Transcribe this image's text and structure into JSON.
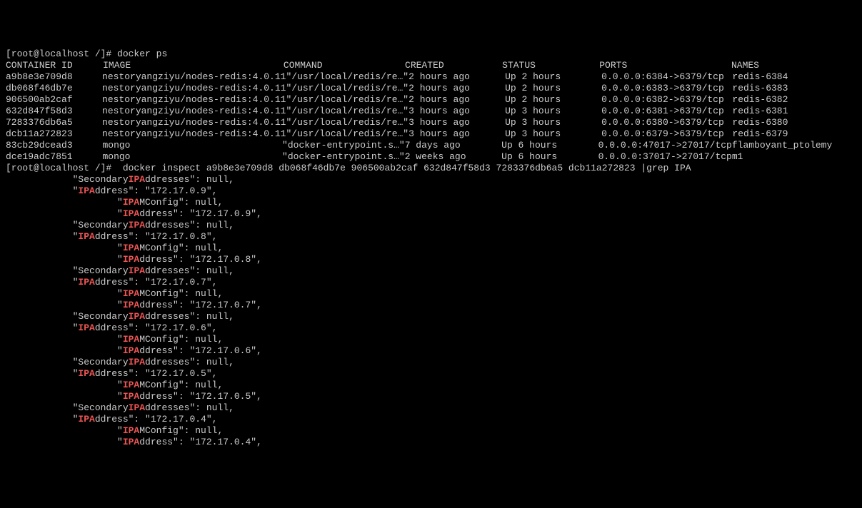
{
  "prompt1": "[root@localhost /]# ",
  "cmd1": "docker ps",
  "headers": {
    "container_id": "CONTAINER ID",
    "image": "IMAGE",
    "command": "COMMAND",
    "created": "CREATED",
    "status": "STATUS",
    "ports": "PORTS",
    "names": "NAMES"
  },
  "containers": [
    {
      "id": "a9b8e3e709d8",
      "image": "nestoryangziyu/nodes-redis:4.0.11",
      "command": "\"/usr/local/redis/re…\"",
      "created": "2 hours ago",
      "status": "Up 2 hours",
      "ports": "0.0.0.0:6384->6379/tcp",
      "names": "redis-6384"
    },
    {
      "id": "db068f46db7e",
      "image": "nestoryangziyu/nodes-redis:4.0.11",
      "command": "\"/usr/local/redis/re…\"",
      "created": "2 hours ago",
      "status": "Up 2 hours",
      "ports": "0.0.0.0:6383->6379/tcp",
      "names": "redis-6383"
    },
    {
      "id": "906500ab2caf",
      "image": "nestoryangziyu/nodes-redis:4.0.11",
      "command": "\"/usr/local/redis/re…\"",
      "created": "2 hours ago",
      "status": "Up 2 hours",
      "ports": "0.0.0.0:6382->6379/tcp",
      "names": "redis-6382"
    },
    {
      "id": "632d847f58d3",
      "image": "nestoryangziyu/nodes-redis:4.0.11",
      "command": "\"/usr/local/redis/re…\"",
      "created": "3 hours ago",
      "status": "Up 3 hours",
      "ports": "0.0.0.0:6381->6379/tcp",
      "names": "redis-6381"
    },
    {
      "id": "7283376db6a5",
      "image": "nestoryangziyu/nodes-redis:4.0.11",
      "command": "\"/usr/local/redis/re…\"",
      "created": "3 hours ago",
      "status": "Up 3 hours",
      "ports": "0.0.0.0:6380->6379/tcp",
      "names": "redis-6380"
    },
    {
      "id": "dcb11a272823",
      "image": "nestoryangziyu/nodes-redis:4.0.11",
      "command": "\"/usr/local/redis/re…\"",
      "created": "3 hours ago",
      "status": "Up 3 hours",
      "ports": "0.0.0.0:6379->6379/tcp",
      "names": "redis-6379"
    },
    {
      "id": "83cb29dcead3",
      "image": "mongo",
      "command": "\"docker-entrypoint.s…\"",
      "created": "7 days ago",
      "status": "Up 6 hours",
      "ports": "0.0.0.0:47017->27017/tcp",
      "names": "flamboyant_ptolemy"
    },
    {
      "id": "dce19adc7851",
      "image": "mongo",
      "command": "\"docker-entrypoint.s…\"",
      "created": "2 weeks ago",
      "status": "Up 6 hours",
      "ports": "0.0.0.0:37017->27017/tcp",
      "names": "m1"
    }
  ],
  "prompt2": "[root@localhost /]#  ",
  "cmd2": "docker inspect a9b8e3e709d8 db068f46db7e 906500ab2caf 632d847f58d3 7283376db6a5 dcb11a272823 |grep IPA",
  "grep_blocks": [
    {
      "sec": "            \"Secondary",
      "sec_x": "ddresses\": null,",
      "ipa": "            \"",
      "ip": "172.17.0.9",
      "cfg": "                    \"",
      "cfg_tail": "MConfig\": null,",
      "in": "                    \"",
      "in_tail": "ddress\": \"172.17.0.9\","
    },
    {
      "sec": "            \"Secondary",
      "sec_x": "ddresses\": null,",
      "ipa": "            \"",
      "ip": "172.17.0.8",
      "cfg": "                    \"",
      "cfg_tail": "MConfig\": null,",
      "in": "                    \"",
      "in_tail": "ddress\": \"172.17.0.8\","
    },
    {
      "sec": "            \"Secondary",
      "sec_x": "ddresses\": null,",
      "ipa": "            \"",
      "ip": "172.17.0.7",
      "cfg": "                    \"",
      "cfg_tail": "MConfig\": null,",
      "in": "                    \"",
      "in_tail": "ddress\": \"172.17.0.7\","
    },
    {
      "sec": "            \"Secondary",
      "sec_x": "ddresses\": null,",
      "ipa": "            \"",
      "ip": "172.17.0.6",
      "cfg": "                    \"",
      "cfg_tail": "MConfig\": null,",
      "in": "                    \"",
      "in_tail": "ddress\": \"172.17.0.6\","
    },
    {
      "sec": "            \"Secondary",
      "sec_x": "ddresses\": null,",
      "ipa": "            \"",
      "ip": "172.17.0.5",
      "cfg": "                    \"",
      "cfg_tail": "MConfig\": null,",
      "in": "                    \"",
      "in_tail": "ddress\": \"172.17.0.5\","
    },
    {
      "sec": "            \"Secondary",
      "sec_x": "ddresses\": null,",
      "ipa": "            \"",
      "ip": "172.17.0.4",
      "cfg": "                    \"",
      "cfg_tail": "MConfig\": null,",
      "in": "                    \"",
      "in_tail": "ddress\": \"172.17.0.4\","
    }
  ],
  "ipa_hl": "IPA",
  "dress_tail": "ddress\": \""
}
